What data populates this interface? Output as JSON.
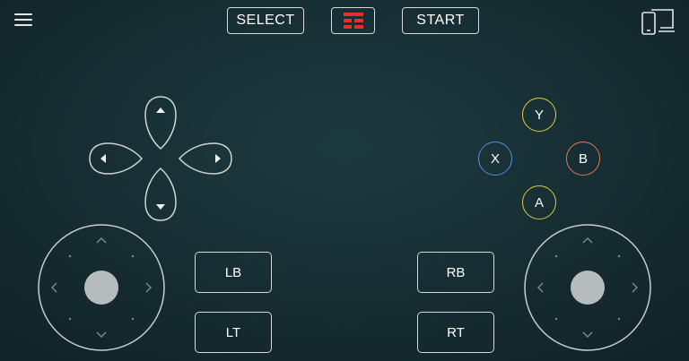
{
  "header": {
    "menu_icon": "hamburger-menu-icon",
    "select_label": "SELECT",
    "start_label": "START",
    "logo_icon": "app-logo-icon",
    "cast_icon": "screen-cast-icon"
  },
  "dpad": {
    "up_icon": "dpad-up-arrow-icon",
    "down_icon": "dpad-down-arrow-icon",
    "left_icon": "dpad-left-arrow-icon",
    "right_icon": "dpad-right-arrow-icon"
  },
  "face_buttons": {
    "y": "Y",
    "x": "X",
    "b": "B",
    "a": "A"
  },
  "shoulders": {
    "lb": "LB",
    "lt": "LT",
    "rb": "RB",
    "rt": "RT"
  },
  "colors": {
    "y": "#e3c93a",
    "x": "#4f8fe0",
    "b": "#e07a4e",
    "a": "#d6c83a",
    "logo_red": "#e53030"
  }
}
